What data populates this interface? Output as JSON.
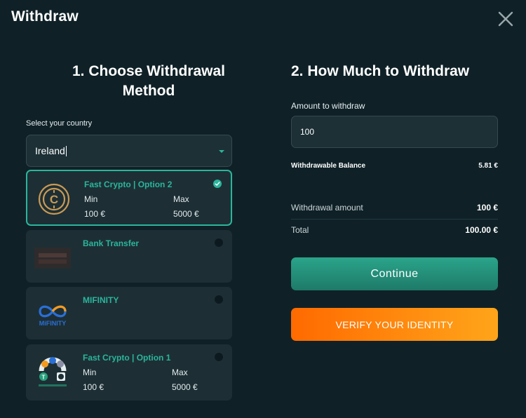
{
  "header": {
    "title": "Withdraw"
  },
  "left": {
    "heading_line1": "1. Choose Withdrawal",
    "heading_line2": "Method",
    "country_label": "Select your country",
    "country_value": "Ireland"
  },
  "methods": [
    {
      "name": "Fast Crypto | Option 2",
      "min_label": "Min",
      "max_label": "Max",
      "min": "100 €",
      "max": "5000 €",
      "selected": true,
      "logo": "crypto-coin-icon"
    },
    {
      "name": "Bank Transfer",
      "selected": false,
      "logo": "bank-transfer-logo"
    },
    {
      "name": "MIFINITY",
      "logo_text": "MiFINITY",
      "selected": false,
      "logo": "mifinity-logo"
    },
    {
      "name": "Fast Crypto | Option 1",
      "min_label": "Min",
      "max_label": "Max",
      "min": "100 €",
      "max": "5000 €",
      "selected": false,
      "logo": "crypto-coins-cluster-icon"
    }
  ],
  "right": {
    "heading": "2. How Much to Withdraw",
    "amount_label": "Amount to withdraw",
    "amount_value": "100",
    "balance_label": "Withdrawable Balance",
    "balance_value": "5.81 €",
    "withdrawal_label": "Withdrawal amount",
    "withdrawal_value": "100 €",
    "total_label": "Total",
    "total_value": "100.00 €",
    "continue_label": "Continue",
    "verify_label": "VERIFY YOUR IDENTITY"
  },
  "colors": {
    "accent": "#2bb59c",
    "background": "#0f2127",
    "card": "#1d2f35",
    "orange_start": "#ff6a00",
    "orange_end": "#ffa51a"
  }
}
